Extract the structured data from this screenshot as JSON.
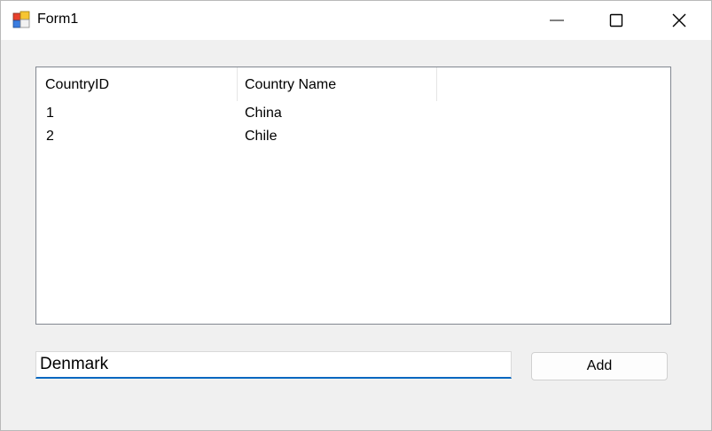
{
  "window": {
    "title": "Form1",
    "icon": "winforms-app-icon",
    "controls": {
      "minimize_icon": "minimize-icon",
      "maximize_icon": "maximize-icon",
      "close_icon": "close-icon"
    }
  },
  "listview": {
    "columns": [
      "CountryID",
      "Country Name"
    ],
    "rows": [
      [
        "1",
        "China"
      ],
      [
        "2",
        "Chile"
      ]
    ]
  },
  "input": {
    "value": "Denmark"
  },
  "add_button": {
    "label": "Add"
  },
  "colors": {
    "accent": "#0067c0",
    "window_bg": "#f0f0f0",
    "titlebar_bg": "#ffffff"
  }
}
